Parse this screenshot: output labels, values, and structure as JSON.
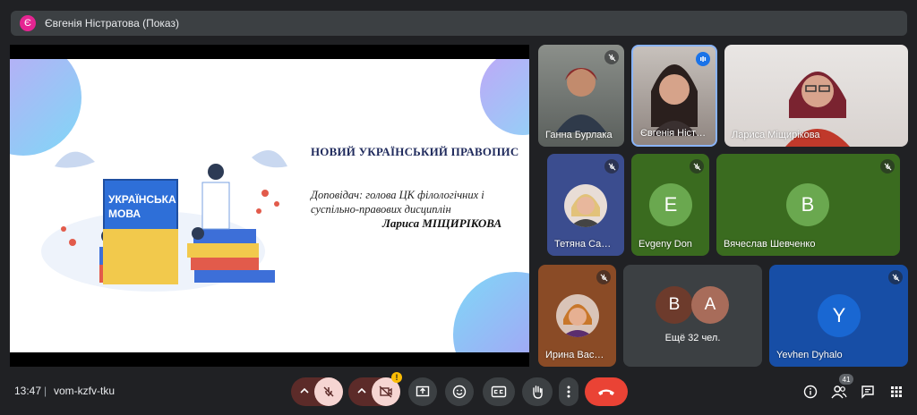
{
  "topbar": {
    "presenter_initial": "Є",
    "presenter_title": "Євгенія Ністратова (Показ)"
  },
  "slide": {
    "title": "НОВИЙ УКРАЇНСЬКИЙ ПРАВОПИС",
    "subtitle": "Доповідач:  голова ЦК філологічних і суспільно-правових дисциплін",
    "speaker": "Лариса МІЩИРІКОВА",
    "book_line1": "УКРАЇНСЬКА",
    "book_line2": "МОВА"
  },
  "participants": [
    {
      "name": "Ганна Бурлака",
      "muted": true
    },
    {
      "name": "Євгенія Ніст…",
      "speaking": true
    },
    {
      "name": "Лариса Міщирікова"
    },
    {
      "name": "Тетяна Са…",
      "muted": true
    },
    {
      "name": "Evgeny Don",
      "initial": "E",
      "muted": true
    },
    {
      "name": "Вячеслав Шевченко",
      "initial": "В",
      "muted": true
    },
    {
      "name": "Ирина Вас…",
      "muted": true
    },
    {
      "name": "Ещё 32 чел.",
      "initials": [
        "В",
        "A"
      ]
    },
    {
      "name": "Yevhen Dyhalo",
      "initial": "Y",
      "muted": true
    }
  ],
  "bottombar": {
    "time": "13:47",
    "separator": "|",
    "meeting_code": "vom-kzfv-tku",
    "people_count": "41"
  },
  "colors": {
    "end_call": "#ea4335",
    "muted_control": "#f6d5d2",
    "muted_control_dark": "#5c2b29",
    "tile_green": "#3a6b1f",
    "avatar_green": "#6aa84f",
    "tile_blue": "#174ea6",
    "avatar_blue": "#1967d2",
    "tile_orange": "#8a4b26",
    "avatar_brown": "#6d3b2c",
    "avatar_tan": "#a86c5a"
  }
}
